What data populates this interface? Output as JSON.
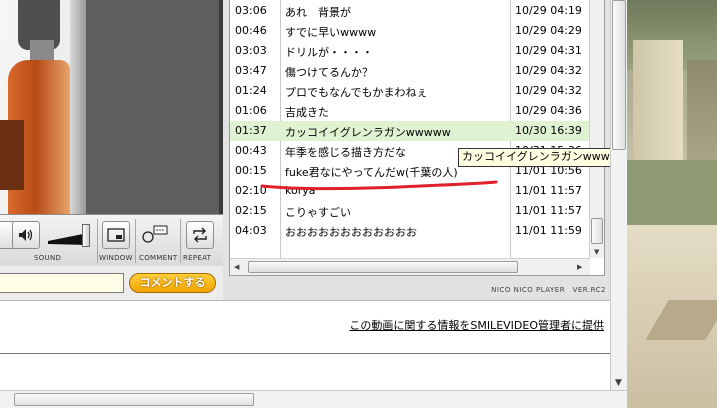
{
  "controls": {
    "sound_label": "SOUND",
    "window_label": "WINDOW",
    "comment_label": "COMMENT",
    "repeat_label": "REPEAT",
    "volume_level": 0.85
  },
  "comment_form": {
    "input_value": "",
    "submit_label": "コメントする"
  },
  "comments": [
    {
      "time": "03:06",
      "text": "あれ　背景が",
      "date": "10/29 04:19"
    },
    {
      "time": "00:46",
      "text": "すでに早いwwww",
      "date": "10/29 04:29"
    },
    {
      "time": "03:03",
      "text": "ドリルが・・・・",
      "date": "10/29 04:31"
    },
    {
      "time": "03:47",
      "text": "傷つけてるんか？",
      "date": "10/29 04:32"
    },
    {
      "time": "01:24",
      "text": "プロでもなんでもかまわねぇ",
      "date": "10/29 04:32"
    },
    {
      "time": "01:06",
      "text": "吉成きた",
      "date": "10/29 04:36"
    },
    {
      "time": "01:37",
      "text": "カッコイイグレンラガンwwwww",
      "date": "10/30 16:39"
    },
    {
      "time": "00:43",
      "text": "年季を感じる描き方だな",
      "date": "10/31 15:36"
    },
    {
      "time": "00:15",
      "text": "fuke君なにやってんだw(千葉の人)",
      "date": "11/01 10:56"
    },
    {
      "time": "02:10",
      "text": "korya",
      "date": "11/01 11:57"
    },
    {
      "time": "02:15",
      "text": "こりゃすごい",
      "date": "11/01 11:57"
    },
    {
      "time": "04:03",
      "text": "おおおおおおおおおおおお",
      "date": "11/01 11:59"
    }
  ],
  "tooltip": "カッコイイグレンラガンwwwww",
  "player_version": "NICO NICO PLAYER　VER.RC2",
  "report_link": "この動画に関する情報をSMILEVIDEO管理者に提供",
  "colors": {
    "highlight_row": "#dff3d2",
    "submit_button": "#f1a400",
    "annotation_underline": "#e0202a"
  }
}
